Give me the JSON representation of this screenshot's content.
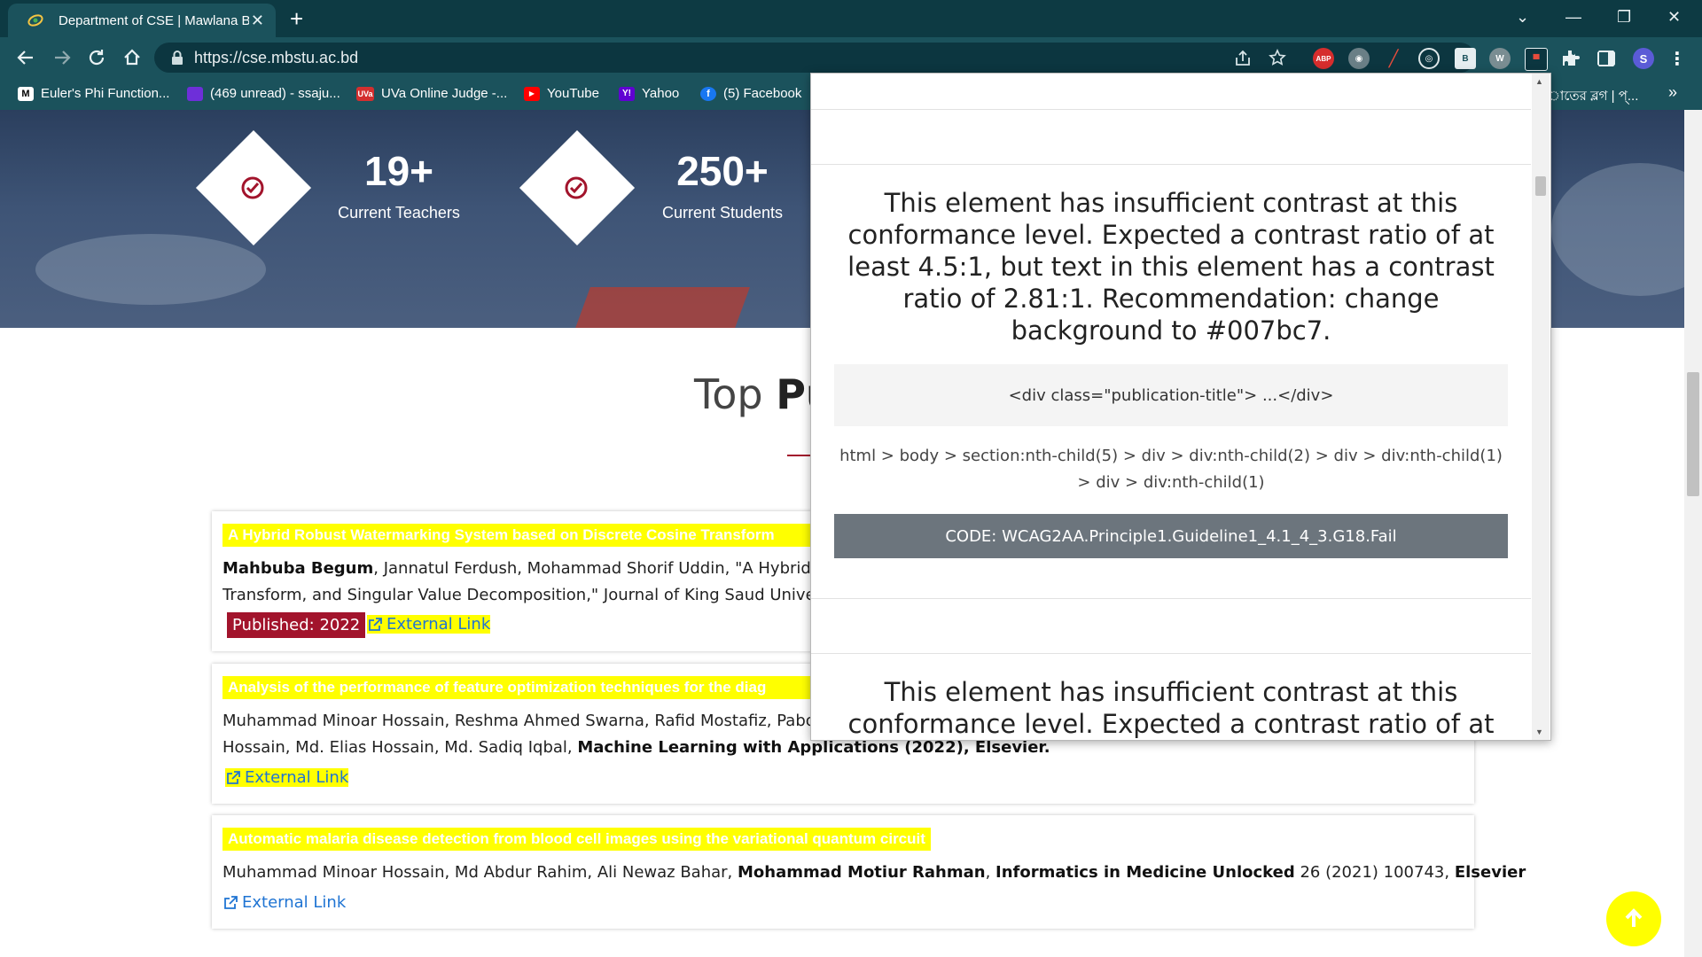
{
  "browser": {
    "tab_title": "Department of CSE | Mawlana Bhashani Science and Technology University",
    "tab_close": "✕",
    "new_tab": "+",
    "url": "https://cse.mbstu.ac.bd",
    "profile_initial": "S",
    "window_controls": {
      "dropdown": "⌄",
      "minimize": "—",
      "restore": "❐",
      "close": "✕"
    },
    "extensions": [
      "ABP",
      "B",
      "W"
    ]
  },
  "bookmarks": [
    {
      "icon": "M",
      "label": "Euler's Phi Function..."
    },
    {
      "icon": "mail",
      "label": "(469 unread) - ssaju..."
    },
    {
      "icon": "UVa",
      "label": "UVa Online Judge -..."
    },
    {
      "icon": "youtube",
      "label": "YouTube"
    },
    {
      "icon": "Y!",
      "label": "Yahoo"
    },
    {
      "icon": "f",
      "label": "(5) Facebook"
    }
  ],
  "bookmarks_tail": "াতের ব্লগ | প্...",
  "bookmarks_overflow": "»",
  "stats": [
    {
      "number": "19+",
      "label": "Current Teachers"
    },
    {
      "number": "250+",
      "label": "Current Students"
    }
  ],
  "section": {
    "title_light": "Top ",
    "title_bold": "Pu"
  },
  "publications": [
    {
      "title": "A Hybrid Robust Watermarking System based on Discrete Cosine Transform",
      "author_bold": "Mahbuba Begum",
      "text_rest": ", Jannatul Ferdush, Mohammad Shorif Uddin, \"A Hybrid R",
      "line2": "Transform, and Singular Value Decomposition,\" Journal of King Saud University-C",
      "badge": "Published: 2022",
      "link": "External Link"
    },
    {
      "title": "Analysis of the performance of feature optimization techniques for the diag",
      "line1": "Muhammad Minoar Hossain, Reshma Ahmed Swarna, Rafid Mostafiz, Pabon S",
      "line2_plain": "Hossain, Md. Elias Hossain, Md. Sadiq Iqbal, ",
      "line2_bold": "Machine Learning with Applications (2022), Elsevier.",
      "link": "External Link"
    },
    {
      "title": "Automatic malaria disease detection from blood cell images using the variational quantum circuit",
      "authors_plain": "Muhammad Minoar Hossain, Md Abdur Rahim, Ali Newaz Bahar, ",
      "author_bold": "Mohammad Motiur Rahman",
      "sep": ", ",
      "journal_bold": "Informatics in Medicine Unlocked",
      "details": " 26 (2021) 100743, ",
      "publisher_bold": "Elsevier",
      "link": "External Link"
    }
  ],
  "popup": {
    "issue_message": "This element has insufficient contrast at this conformance level. Expected a contrast ratio of at least 4.5:1, but text in this element has a contrast ratio of 2.81:1. Recommendation: change background to #007bc7.",
    "element_code": "<div class=\"publication-title\"> ...</div>",
    "selector": "html > body > section:nth-child(5) > div > div:nth-child(2) > div > div:nth-child(1) > div > div:nth-child(1)",
    "wcag_code": "CODE: WCAG2AA.Principle1.Guideline1_4.1_4_3.G18.Fail",
    "next_issue_message": "This element has insufficient contrast at this conformance level. Expected a contrast ratio of at least"
  },
  "colors": {
    "accent": "#a2142c",
    "highlight": "#ffff00",
    "link": "#1f74d3",
    "chrome": "#1b525c"
  }
}
